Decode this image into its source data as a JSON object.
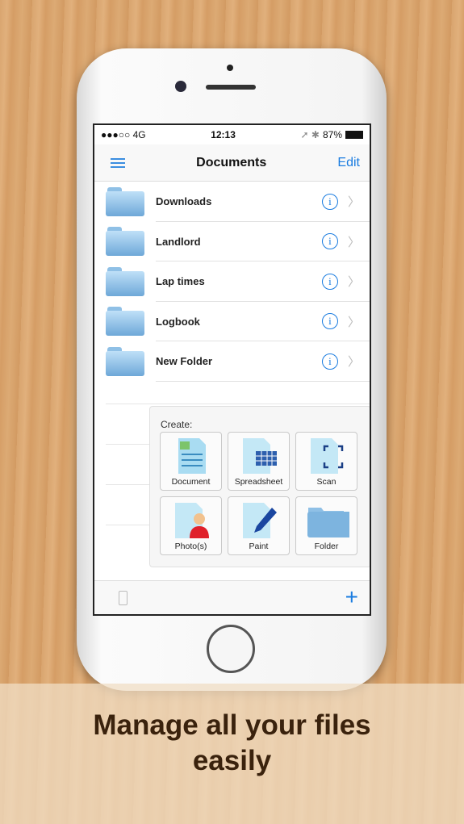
{
  "status_bar": {
    "signal": "●●●○○ 4G",
    "time": "12:13",
    "icons": "➚ ✱",
    "battery": "87%"
  },
  "nav": {
    "title": "Documents",
    "edit": "Edit",
    "menu_icon": "hamburger-icon"
  },
  "folders": [
    {
      "name": "Downloads"
    },
    {
      "name": "Landlord"
    },
    {
      "name": "Lap times"
    },
    {
      "name": "Logbook"
    },
    {
      "name": "New Folder"
    }
  ],
  "create": {
    "label": "Create:",
    "items": [
      {
        "label": "Document"
      },
      {
        "label": "Spreadsheet"
      },
      {
        "label": "Scan"
      },
      {
        "label": "Photo(s)"
      },
      {
        "label": "Paint"
      },
      {
        "label": "Folder"
      }
    ]
  },
  "toolbar": {
    "plus": "+"
  },
  "banner": {
    "line1": "Manage all your files",
    "line2": "easily"
  },
  "colors": {
    "accent": "#1a7ce0",
    "banner_text": "#3a220d"
  }
}
